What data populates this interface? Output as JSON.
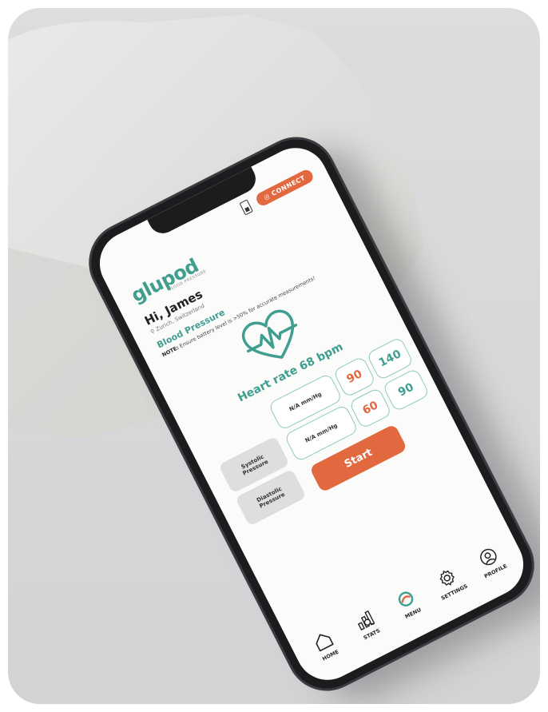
{
  "header": {
    "connect_label": "CONNECT"
  },
  "brand": {
    "logo_text": "glupod",
    "tagline": "BLOOD PRESSURE"
  },
  "user": {
    "greeting": "Hi, James",
    "location": "Zurich, Switzerland"
  },
  "blood_pressure": {
    "title": "Blood Pressure",
    "note_label": "NOTE:",
    "note_text": "Ensure battery level is >50% for accurate measurements!",
    "heart_rate": "Heart rate 68 bpm",
    "systolic": {
      "label_line1": "Systolic",
      "label_line2": "Pressure",
      "reading": "N/A mm/Hg",
      "low": "90",
      "high": "140"
    },
    "diastolic": {
      "label_line1": "Diastolic",
      "label_line2": "Pressure",
      "reading": "N/A mm/Hg",
      "low": "60",
      "high": "90"
    },
    "start_label": "Start"
  },
  "nav": {
    "items": [
      {
        "label": "HOME",
        "icon": "home-icon"
      },
      {
        "label": "STATS",
        "icon": "stats-icon"
      },
      {
        "label": "MENU",
        "icon": "menu-logo-icon"
      },
      {
        "label": "SETTINGS",
        "icon": "gear-icon"
      },
      {
        "label": "PROFILE",
        "icon": "profile-icon"
      }
    ]
  },
  "colors": {
    "accent": "#e2683f",
    "brand": "#3f9e8f"
  }
}
